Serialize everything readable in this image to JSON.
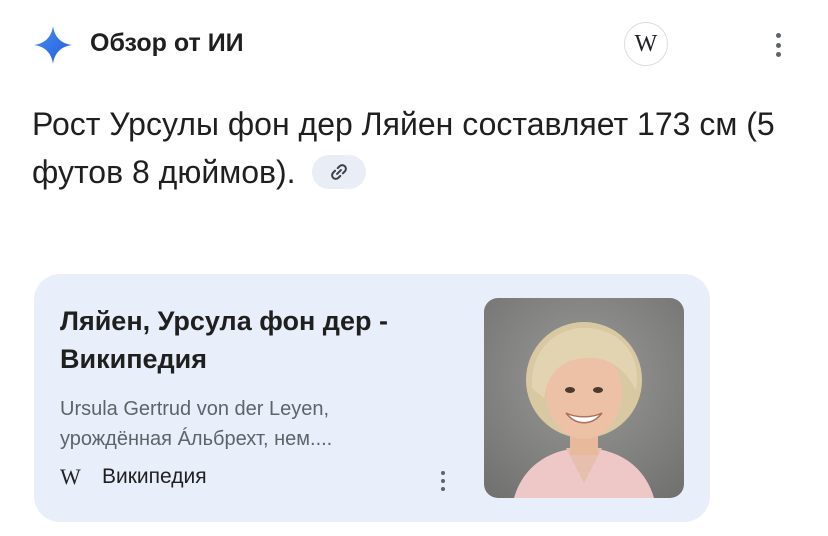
{
  "header": {
    "title": "Обзор от ИИ",
    "source_icon": "W",
    "spark_color": "#1a73e8"
  },
  "answer": {
    "text": "Рост Урсулы фон дер Ляйен составляет 173 см (5 футов 8 дюймов)."
  },
  "card": {
    "title": "Ляйен, Урсула фон дер - Википедия",
    "snippet": "Ursula Gertrud von der Leyen, урождённая Áльбрехт, нем....",
    "source_icon": "W",
    "source_name": "Википедия",
    "image_alt": "portrait-photo"
  },
  "colors": {
    "card_bg": "#e8eefa",
    "chip_bg": "#e9eef6",
    "text_secondary": "#5f6368"
  }
}
